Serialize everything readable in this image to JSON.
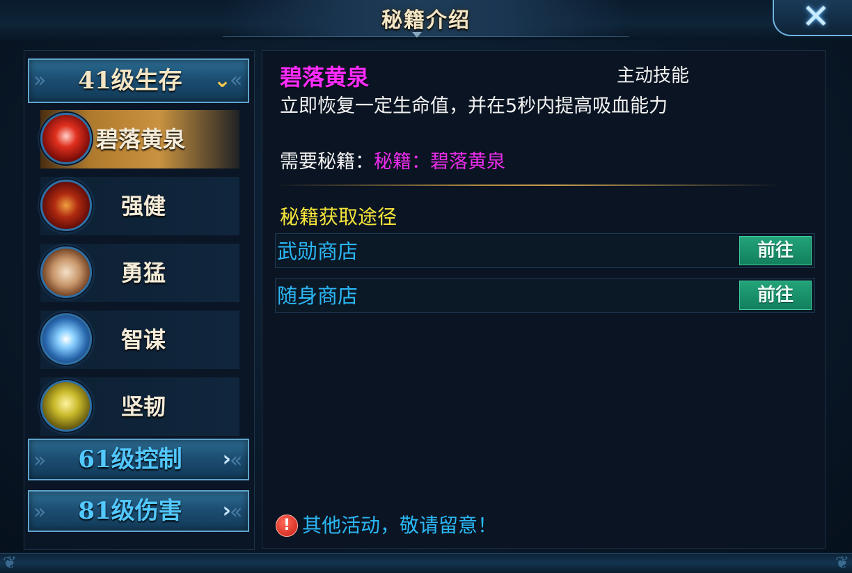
{
  "window": {
    "title": "秘籍介绍"
  },
  "categories": [
    {
      "label": "41级生存",
      "state": "expanded",
      "arrow_icon": "chevron-down-icon"
    },
    {
      "label": "61级控制",
      "state": "collapsed",
      "arrow_icon": "chevron-right-icon"
    },
    {
      "label": "81级伤害",
      "state": "collapsed",
      "arrow_icon": "chevron-right-icon"
    }
  ],
  "skills": [
    {
      "name": "碧落黄泉",
      "icon": "red-energy-skill-icon",
      "selected": true
    },
    {
      "name": "强健",
      "icon": "red-body-skill-icon",
      "selected": false
    },
    {
      "name": "勇猛",
      "icon": "fist-skill-icon",
      "selected": false
    },
    {
      "name": "智谋",
      "icon": "blue-orb-skill-icon",
      "selected": false
    },
    {
      "name": "坚韧",
      "icon": "yellow-gem-skill-icon",
      "selected": false
    }
  ],
  "detail": {
    "title": "碧落黄泉",
    "type": "主动技能",
    "description": "立即恢复一定生命值，并在5秒内提高吸血能力",
    "requirement_label": "需要秘籍：",
    "requirement_value": "秘籍：碧落黄泉",
    "source_heading": "秘籍获取途径",
    "sources": [
      {
        "name": "武勋商店",
        "button": "前往"
      },
      {
        "name": "随身商店",
        "button": "前往"
      }
    ],
    "notice": "其他活动，敬请留意！",
    "notice_icon": "!"
  },
  "colors": {
    "title_gold": "#f4e6c4",
    "skill_title_magenta": "#ff2cff",
    "source_blue": "#2bb7f5",
    "heading_yellow": "#f5e43a",
    "go_button_green": "#11805c",
    "selected_row_gold": "#c89240"
  }
}
